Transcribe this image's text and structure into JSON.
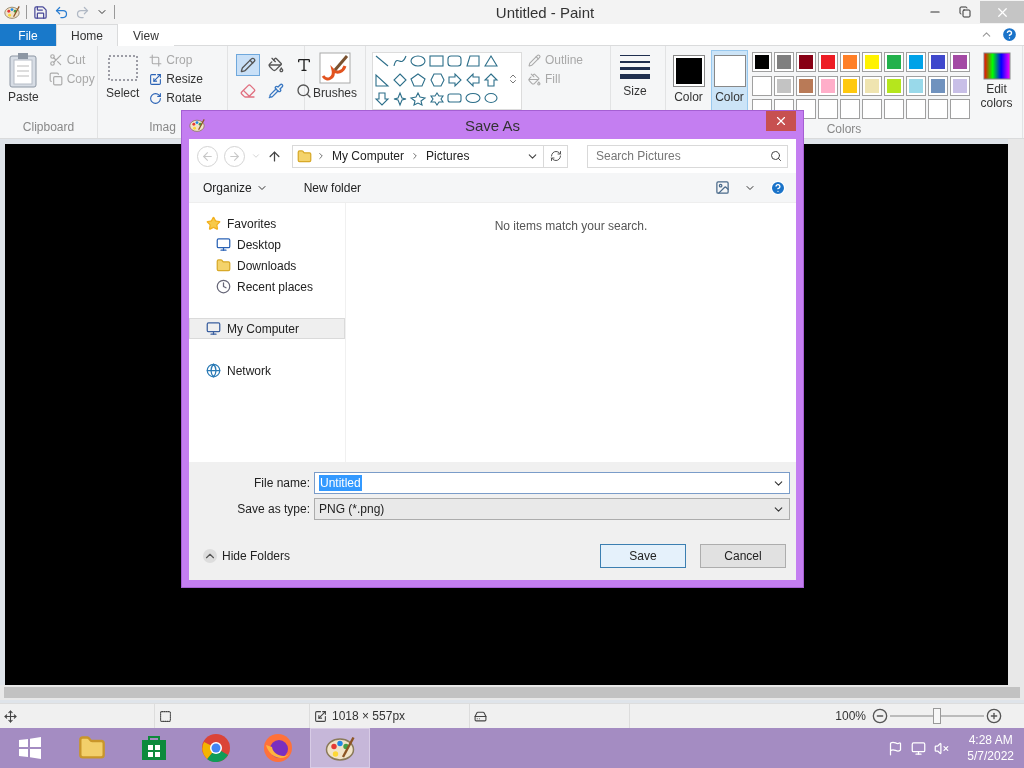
{
  "window": {
    "title": "Untitled - Paint"
  },
  "tabs": [
    {
      "label": "File",
      "kind": "file",
      "selected": false
    },
    {
      "label": "Home",
      "kind": "tab",
      "selected": true
    },
    {
      "label": "View",
      "kind": "tab",
      "selected": false
    }
  ],
  "ribbon": {
    "clipboard": {
      "paste": "Paste",
      "cut": {
        "label": "Cut",
        "disabled": true
      },
      "copy": {
        "label": "Copy",
        "disabled": true
      },
      "group_label": "Clipboard"
    },
    "image": {
      "select": "Select",
      "crop": {
        "label": "Crop",
        "disabled": true
      },
      "resize": {
        "label": "Resize",
        "disabled": false
      },
      "rotate": {
        "label": "Rotate",
        "disabled": false
      },
      "group_label": "Imag"
    },
    "tools": [
      {
        "selected": true
      },
      {
        "selected": false
      },
      {
        "selected": false
      },
      {
        "selected": false
      },
      {
        "selected": false
      },
      {
        "selected": false
      }
    ],
    "brushes": "Brushes",
    "shapes": {
      "outline": {
        "label": "Outline",
        "disabled": true
      },
      "fill": {
        "label": "Fill",
        "disabled": true
      }
    },
    "size": "Size",
    "colors": {
      "slots": [
        {
          "label": "Color",
          "color": "#000000",
          "selected": false
        },
        {
          "label": "Color",
          "color": "#ffffff",
          "selected": true
        }
      ],
      "palette": [
        {
          "color": "#000000"
        },
        {
          "color": "#7f7f7f"
        },
        {
          "color": "#880015"
        },
        {
          "color": "#ed1c24"
        },
        {
          "color": "#ff7f27"
        },
        {
          "color": "#fff200"
        },
        {
          "color": "#22b14c"
        },
        {
          "color": "#00a2e8"
        },
        {
          "color": "#3f48cc"
        },
        {
          "color": "#a349a4"
        },
        {
          "color": "#ffffff"
        },
        {
          "color": "#c3c3c3"
        },
        {
          "color": "#b97a57"
        },
        {
          "color": "#ffaec9"
        },
        {
          "color": "#ffc90e"
        },
        {
          "color": "#efe4b0"
        },
        {
          "color": "#b5e61d"
        },
        {
          "color": "#99d9ea"
        },
        {
          "color": "#7092be"
        },
        {
          "color": "#c8bfe7"
        }
      ],
      "group_label": "Colors",
      "edit_colors": "Edit colors"
    }
  },
  "status_bar": {
    "dimensions": "1018 × 557px",
    "zoom": "100%",
    "zoom_slider": {
      "level": 0.5
    }
  },
  "taskbar": {
    "apps": [
      {
        "selected": false
      },
      {
        "selected": false
      },
      {
        "selected": false
      },
      {
        "selected": false
      },
      {
        "selected": true
      }
    ],
    "time": "4:28 AM",
    "date": "5/7/2022"
  },
  "dialog": {
    "title": "Save As",
    "back": {
      "disabled": true
    },
    "forward": {
      "disabled": true
    },
    "breadcrumb": [
      "My Computer",
      "Pictures"
    ],
    "search": {
      "placeholder": "Search Pictures"
    },
    "organize": "Organize",
    "new_folder": "New folder",
    "tree": [
      {
        "label": "Favorites",
        "selected": false,
        "children": [
          {
            "label": "Desktop",
            "selected": false
          },
          {
            "label": "Downloads",
            "selected": false
          },
          {
            "label": "Recent places",
            "selected": false
          }
        ]
      },
      {
        "label": "My Computer",
        "selected": true
      },
      {
        "label": "Network",
        "selected": false
      }
    ],
    "empty_message": "No items match your search.",
    "file_name": {
      "label": "File name:",
      "value": "Untitled",
      "text_selected": true
    },
    "save_type": {
      "label": "Save as type:",
      "value": "PNG (*.png)"
    },
    "hide_folders": "Hide Folders",
    "buttons": [
      {
        "label": "Save",
        "kind": "default"
      },
      {
        "label": "Cancel",
        "kind": "normal"
      }
    ]
  }
}
